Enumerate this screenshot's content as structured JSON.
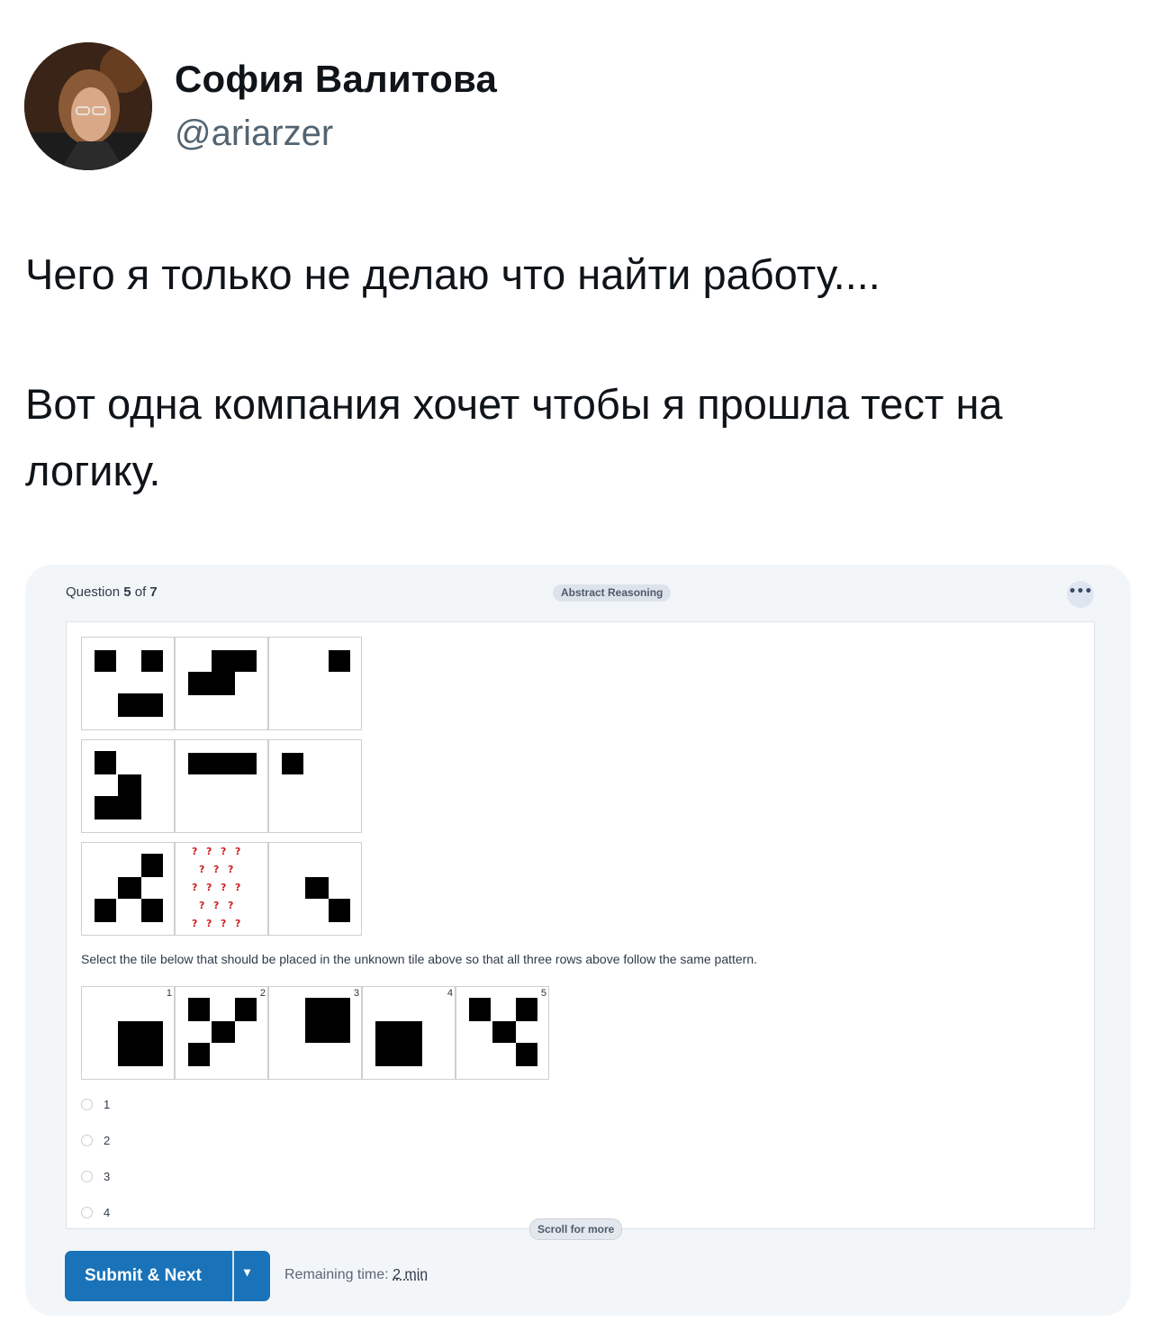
{
  "tweet": {
    "author_name": "София Валитова",
    "author_handle": "@ariarzer",
    "paragraph1": "Чего я только не делаю что найти работу....",
    "paragraph2": "Вот одна компания хочет чтобы я прошла тест на логику."
  },
  "quiz": {
    "question_prefix": "Question",
    "question_current": "5",
    "question_of": "of",
    "question_total": "7",
    "category_badge": "Abstract Reasoning",
    "more_icon": "more-dots-icon",
    "unknown_tile_symbol": "?",
    "instruction": "Select the tile below that should be placed in the unknown tile above so that all three rows above follow the same pattern.",
    "option_tile_numbers": [
      "1",
      "2",
      "3",
      "4",
      "5"
    ],
    "answers": [
      "1",
      "2",
      "3",
      "4"
    ],
    "scroll_hint": "Scroll for more",
    "submit_label": "Submit & Next",
    "remaining_label": "Remaining time:",
    "remaining_value": "2 min",
    "accent_color": "#1a73b8"
  }
}
